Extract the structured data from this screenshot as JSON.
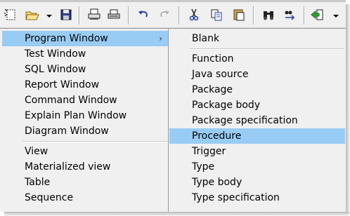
{
  "toolbar": {
    "buttons": [
      {
        "name": "new-icon"
      },
      {
        "name": "open-folder-icon"
      },
      {
        "name": "save-icon"
      },
      {
        "name": "print-icon"
      },
      {
        "name": "print-preview-icon"
      },
      {
        "name": "undo-icon"
      },
      {
        "name": "redo-icon"
      },
      {
        "name": "cut-icon"
      },
      {
        "name": "copy-icon"
      },
      {
        "name": "paste-icon"
      },
      {
        "name": "find-icon"
      },
      {
        "name": "replace-icon"
      },
      {
        "name": "green-arrow-icon"
      }
    ]
  },
  "left_menu": {
    "group1": [
      "Program Window",
      "Test Window",
      "SQL Window",
      "Report Window",
      "Command Window",
      "Explain Plan Window",
      "Diagram Window"
    ],
    "group2": [
      "View",
      "Materialized view",
      "Table",
      "Sequence"
    ],
    "submenu_arrow": "›"
  },
  "right_menu": {
    "group1": [
      "Blank"
    ],
    "group2": [
      "Function",
      "Java source",
      "Package",
      "Package body",
      "Package specification",
      "Procedure",
      "Trigger",
      "Type",
      "Type body",
      "Type specification"
    ]
  },
  "colors": {
    "highlight": "#99ccf4",
    "menu_bg": "#f0f0f0",
    "border": "#9a9a9a"
  }
}
